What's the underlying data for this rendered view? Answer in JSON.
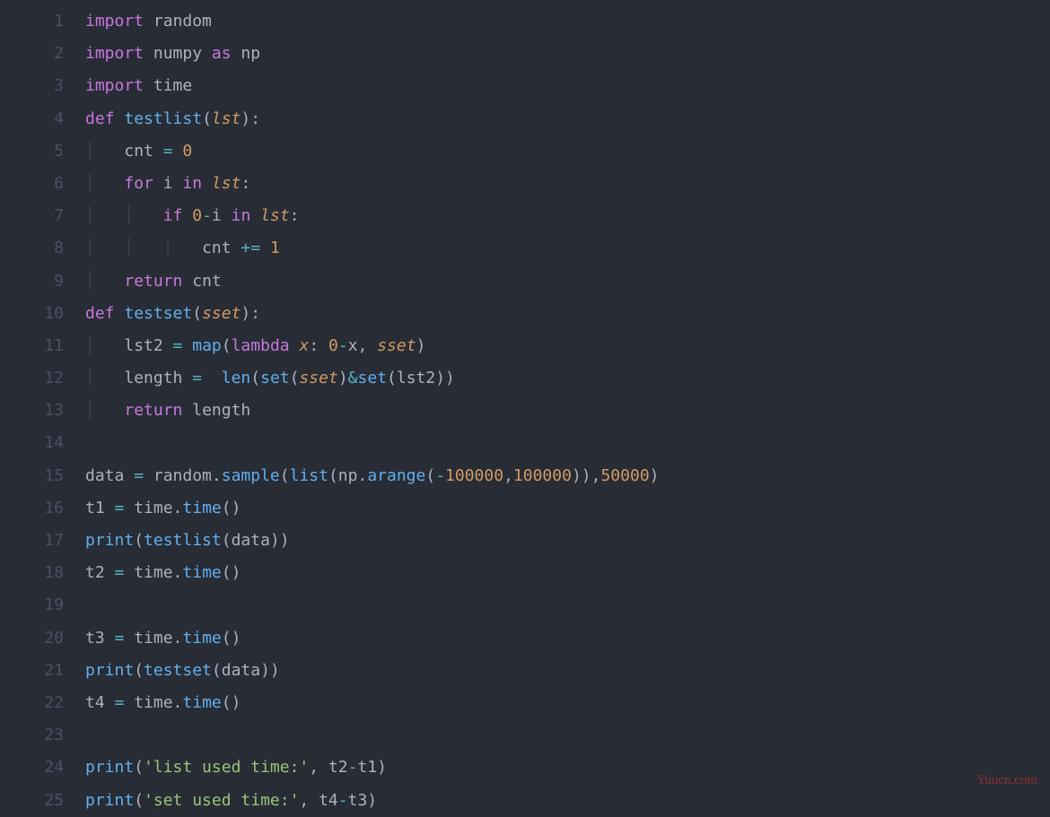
{
  "watermark": "Yuucn.com",
  "line_numbers": [
    "1",
    "2",
    "3",
    "4",
    "5",
    "6",
    "7",
    "8",
    "9",
    "10",
    "11",
    "12",
    "13",
    "14",
    "15",
    "16",
    "17",
    "18",
    "19",
    "20",
    "21",
    "22",
    "23",
    "24",
    "25"
  ],
  "lines": [
    [
      {
        "c": "tok-kw",
        "t": "import"
      },
      {
        "c": "tok-plain",
        "t": " random"
      }
    ],
    [
      {
        "c": "tok-kw",
        "t": "import"
      },
      {
        "c": "tok-plain",
        "t": " numpy "
      },
      {
        "c": "tok-kw",
        "t": "as"
      },
      {
        "c": "tok-plain",
        "t": " np"
      }
    ],
    [
      {
        "c": "tok-kw",
        "t": "import"
      },
      {
        "c": "tok-plain",
        "t": " time"
      }
    ],
    [
      {
        "c": "tok-kw",
        "t": "def"
      },
      {
        "c": "tok-plain",
        "t": " "
      },
      {
        "c": "tok-fn",
        "t": "testlist"
      },
      {
        "c": "tok-plain",
        "t": "("
      },
      {
        "c": "tok-param",
        "t": "lst"
      },
      {
        "c": "tok-plain",
        "t": "):"
      }
    ],
    [
      {
        "c": "indent-guide",
        "t": "│   "
      },
      {
        "c": "tok-plain",
        "t": "cnt "
      },
      {
        "c": "tok-op",
        "t": "="
      },
      {
        "c": "tok-plain",
        "t": " "
      },
      {
        "c": "tok-num",
        "t": "0"
      }
    ],
    [
      {
        "c": "indent-guide",
        "t": "│   "
      },
      {
        "c": "tok-kw",
        "t": "for"
      },
      {
        "c": "tok-plain",
        "t": " i "
      },
      {
        "c": "tok-kw",
        "t": "in"
      },
      {
        "c": "tok-plain",
        "t": " "
      },
      {
        "c": "tok-param",
        "t": "lst"
      },
      {
        "c": "tok-plain",
        "t": ":"
      }
    ],
    [
      {
        "c": "indent-guide",
        "t": "│   │   "
      },
      {
        "c": "tok-kw",
        "t": "if"
      },
      {
        "c": "tok-plain",
        "t": " "
      },
      {
        "c": "tok-num",
        "t": "0"
      },
      {
        "c": "tok-op",
        "t": "-"
      },
      {
        "c": "tok-plain",
        "t": "i "
      },
      {
        "c": "tok-kw",
        "t": "in"
      },
      {
        "c": "tok-plain",
        "t": " "
      },
      {
        "c": "tok-param",
        "t": "lst"
      },
      {
        "c": "tok-plain",
        "t": ":"
      }
    ],
    [
      {
        "c": "indent-guide",
        "t": "│   │   │   "
      },
      {
        "c": "tok-plain",
        "t": "cnt "
      },
      {
        "c": "tok-op",
        "t": "+="
      },
      {
        "c": "tok-plain",
        "t": " "
      },
      {
        "c": "tok-num",
        "t": "1"
      }
    ],
    [
      {
        "c": "indent-guide",
        "t": "│   "
      },
      {
        "c": "tok-kw",
        "t": "return"
      },
      {
        "c": "tok-plain",
        "t": " cnt"
      }
    ],
    [
      {
        "c": "tok-kw",
        "t": "def"
      },
      {
        "c": "tok-plain",
        "t": " "
      },
      {
        "c": "tok-fn",
        "t": "testset"
      },
      {
        "c": "tok-plain",
        "t": "("
      },
      {
        "c": "tok-param",
        "t": "sset"
      },
      {
        "c": "tok-plain",
        "t": "):"
      }
    ],
    [
      {
        "c": "indent-guide",
        "t": "│   "
      },
      {
        "c": "tok-plain",
        "t": "lst2 "
      },
      {
        "c": "tok-op",
        "t": "="
      },
      {
        "c": "tok-plain",
        "t": " "
      },
      {
        "c": "tok-fn",
        "t": "map"
      },
      {
        "c": "tok-plain",
        "t": "("
      },
      {
        "c": "tok-kw",
        "t": "lambda"
      },
      {
        "c": "tok-plain",
        "t": " "
      },
      {
        "c": "tok-param",
        "t": "x"
      },
      {
        "c": "tok-plain",
        "t": ": "
      },
      {
        "c": "tok-num",
        "t": "0"
      },
      {
        "c": "tok-op",
        "t": "-"
      },
      {
        "c": "tok-plain",
        "t": "x, "
      },
      {
        "c": "tok-param",
        "t": "sset"
      },
      {
        "c": "tok-plain",
        "t": ")"
      }
    ],
    [
      {
        "c": "indent-guide",
        "t": "│   "
      },
      {
        "c": "tok-plain",
        "t": "length "
      },
      {
        "c": "tok-op",
        "t": "="
      },
      {
        "c": "tok-plain",
        "t": "  "
      },
      {
        "c": "tok-fn",
        "t": "len"
      },
      {
        "c": "tok-plain",
        "t": "("
      },
      {
        "c": "tok-fn",
        "t": "set"
      },
      {
        "c": "tok-plain",
        "t": "("
      },
      {
        "c": "tok-param",
        "t": "sset"
      },
      {
        "c": "tok-plain",
        "t": ")"
      },
      {
        "c": "tok-op",
        "t": "&"
      },
      {
        "c": "tok-fn",
        "t": "set"
      },
      {
        "c": "tok-plain",
        "t": "(lst2))"
      }
    ],
    [
      {
        "c": "indent-guide",
        "t": "│   "
      },
      {
        "c": "tok-kw",
        "t": "return"
      },
      {
        "c": "tok-plain",
        "t": " length"
      }
    ],
    [],
    [
      {
        "c": "tok-plain",
        "t": "data "
      },
      {
        "c": "tok-op",
        "t": "="
      },
      {
        "c": "tok-plain",
        "t": " random."
      },
      {
        "c": "tok-fn",
        "t": "sample"
      },
      {
        "c": "tok-plain",
        "t": "("
      },
      {
        "c": "tok-fn",
        "t": "list"
      },
      {
        "c": "tok-plain",
        "t": "(np."
      },
      {
        "c": "tok-fn",
        "t": "arange"
      },
      {
        "c": "tok-plain",
        "t": "("
      },
      {
        "c": "tok-op",
        "t": "-"
      },
      {
        "c": "tok-num",
        "t": "100000"
      },
      {
        "c": "tok-plain",
        "t": ","
      },
      {
        "c": "tok-num",
        "t": "100000"
      },
      {
        "c": "tok-plain",
        "t": ")),"
      },
      {
        "c": "tok-num",
        "t": "50000"
      },
      {
        "c": "tok-plain",
        "t": ")"
      }
    ],
    [
      {
        "c": "tok-plain",
        "t": "t1 "
      },
      {
        "c": "tok-op",
        "t": "="
      },
      {
        "c": "tok-plain",
        "t": " time."
      },
      {
        "c": "tok-fn",
        "t": "time"
      },
      {
        "c": "tok-plain",
        "t": "()"
      }
    ],
    [
      {
        "c": "tok-fn",
        "t": "print"
      },
      {
        "c": "tok-plain",
        "t": "("
      },
      {
        "c": "tok-fn",
        "t": "testlist"
      },
      {
        "c": "tok-plain",
        "t": "(data))"
      }
    ],
    [
      {
        "c": "tok-plain",
        "t": "t2 "
      },
      {
        "c": "tok-op",
        "t": "="
      },
      {
        "c": "tok-plain",
        "t": " time."
      },
      {
        "c": "tok-fn",
        "t": "time"
      },
      {
        "c": "tok-plain",
        "t": "()"
      }
    ],
    [],
    [
      {
        "c": "tok-plain",
        "t": "t3 "
      },
      {
        "c": "tok-op",
        "t": "="
      },
      {
        "c": "tok-plain",
        "t": " time."
      },
      {
        "c": "tok-fn",
        "t": "time"
      },
      {
        "c": "tok-plain",
        "t": "()"
      }
    ],
    [
      {
        "c": "tok-fn",
        "t": "print"
      },
      {
        "c": "tok-plain",
        "t": "("
      },
      {
        "c": "tok-fn",
        "t": "testset"
      },
      {
        "c": "tok-plain",
        "t": "(data))"
      }
    ],
    [
      {
        "c": "tok-plain",
        "t": "t4 "
      },
      {
        "c": "tok-op",
        "t": "="
      },
      {
        "c": "tok-plain",
        "t": " time."
      },
      {
        "c": "tok-fn",
        "t": "time"
      },
      {
        "c": "tok-plain",
        "t": "()"
      }
    ],
    [],
    [
      {
        "c": "tok-fn",
        "t": "print"
      },
      {
        "c": "tok-plain",
        "t": "("
      },
      {
        "c": "tok-str",
        "t": "'list used time:'"
      },
      {
        "c": "tok-plain",
        "t": ", t2"
      },
      {
        "c": "tok-op",
        "t": "-"
      },
      {
        "c": "tok-plain",
        "t": "t1)"
      }
    ],
    [
      {
        "c": "tok-fn",
        "t": "print"
      },
      {
        "c": "tok-plain",
        "t": "("
      },
      {
        "c": "tok-str",
        "t": "'set used time:'"
      },
      {
        "c": "tok-plain",
        "t": ", t4"
      },
      {
        "c": "tok-op",
        "t": "-"
      },
      {
        "c": "tok-plain",
        "t": "t3)"
      }
    ]
  ]
}
